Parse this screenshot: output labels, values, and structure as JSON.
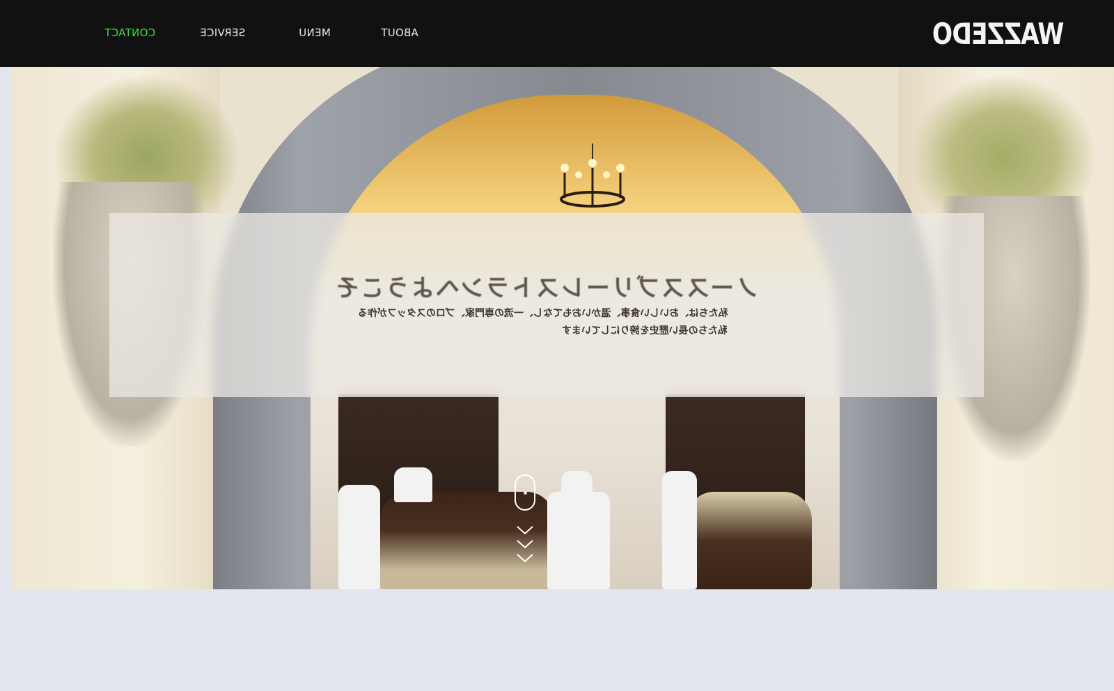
{
  "nav": {
    "links": [
      {
        "label": "CONTACT",
        "active": true
      },
      {
        "label": "SERVICE",
        "active": false
      },
      {
        "label": "MENU",
        "active": false
      },
      {
        "label": "ABOUT",
        "active": false
      }
    ],
    "logo": "WAZZEDO",
    "active_color": "#3ddc3d"
  },
  "hero": {
    "title": "ノーススブリーレストランへようこそ",
    "line1": "私たちは、おいしい食事、温かいおもてなし、一流の専門家、プロのスタッフが作る",
    "line2": "私たちの長い歴史を誇りにしています"
  },
  "scroll_indicator": {
    "mouse_icon": "mouse-icon",
    "chevron_icon": "chevron-down-icon"
  }
}
